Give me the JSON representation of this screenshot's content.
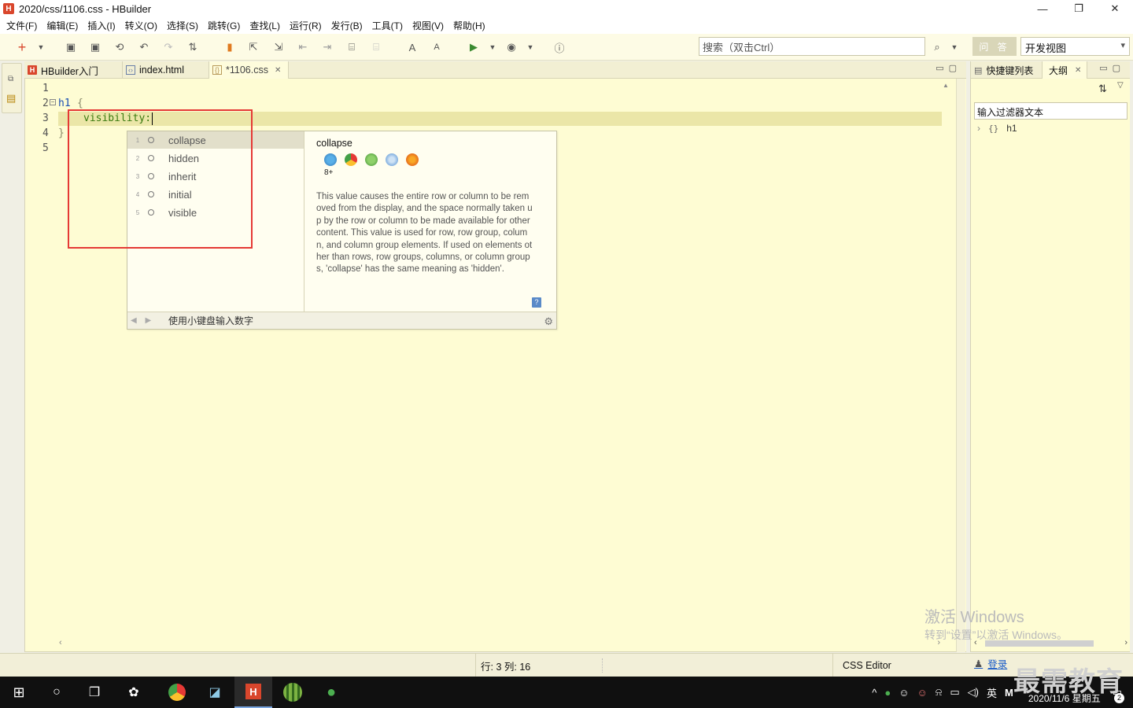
{
  "window": {
    "title": "2020/css/1106.css  -  HBuilder",
    "app_logo": "H",
    "controls": [
      "—",
      "❐",
      "✕"
    ]
  },
  "menu": [
    "文件(F)",
    "编辑(E)",
    "插入(I)",
    "转义(O)",
    "选择(S)",
    "跳转(G)",
    "查找(L)",
    "运行(R)",
    "发行(B)",
    "工具(T)",
    "视图(V)",
    "帮助(H)"
  ],
  "toolbar": {
    "search_placeholder": "搜索（双击Ctrl）",
    "wenda_label": "问 答",
    "view_selected": "开发视图"
  },
  "editor_tabs": [
    {
      "label": "HBuilder入门",
      "icon": "hbuilder-icon"
    },
    {
      "label": "index.html",
      "icon": "html-file-icon"
    },
    {
      "label": "*1106.css",
      "icon": "css-file-icon",
      "close": "✕"
    }
  ],
  "code": {
    "line_numbers": [
      "1",
      "2",
      "3",
      "4",
      "5"
    ],
    "line2_selector": "h1",
    "line2_brace": "{",
    "line3_property": "visibility:",
    "line4_brace": "}"
  },
  "autocomplete": {
    "items": [
      {
        "num": "1",
        "label": "collapse"
      },
      {
        "num": "2",
        "label": "hidden"
      },
      {
        "num": "3",
        "label": "inherit"
      },
      {
        "num": "4",
        "label": "initial"
      },
      {
        "num": "5",
        "label": "visible"
      }
    ],
    "detail_title": "collapse",
    "browser_icons": [
      "ie-icon",
      "chrome-icon",
      "android-icon",
      "safari-icon",
      "firefox-icon"
    ],
    "browser_version": "8+",
    "description": "This value causes the entire row or column to be removed from the display, and the space normally taken up by the row or column to be made available for other content. This value is used for row, row group, column, and column group elements. If used on elements other than rows, row groups, columns, or column groups, 'collapse' has the same meaning as 'hidden'.",
    "footer_hint": "使用小键盘输入数字"
  },
  "right_panel": {
    "tabs": [
      "快捷键列表",
      "大纲"
    ],
    "filter_placeholder": "输入过滤器文本",
    "tree_item": "h1",
    "tree_icon": "{}"
  },
  "statusbar": {
    "position": "行: 3 列: 16",
    "editor_type": "CSS Editor",
    "login": "登录"
  },
  "watermark": {
    "line1": "激活 Windows",
    "line2": "转到“设置”以激活 Windows。"
  },
  "taskbar": {
    "apps": [
      "windows-start-icon",
      "search-icon",
      "task-view-icon",
      "app-icon",
      "chrome-icon",
      "notepad-icon",
      "hbuilder-icon",
      "melon-icon",
      "wechat-icon"
    ],
    "ime": "英",
    "time_partial": "7",
    "date": "2020/11/6 星期五",
    "notification_count": "2"
  },
  "brand_overlay": "最需教育",
  "colors": {
    "editor_bg": "#fefcd3",
    "current_line": "#ebe6a8",
    "keyword_blue": "#1a4fb3",
    "property_green": "#3a7a10",
    "highlight_box": "#e53935"
  }
}
